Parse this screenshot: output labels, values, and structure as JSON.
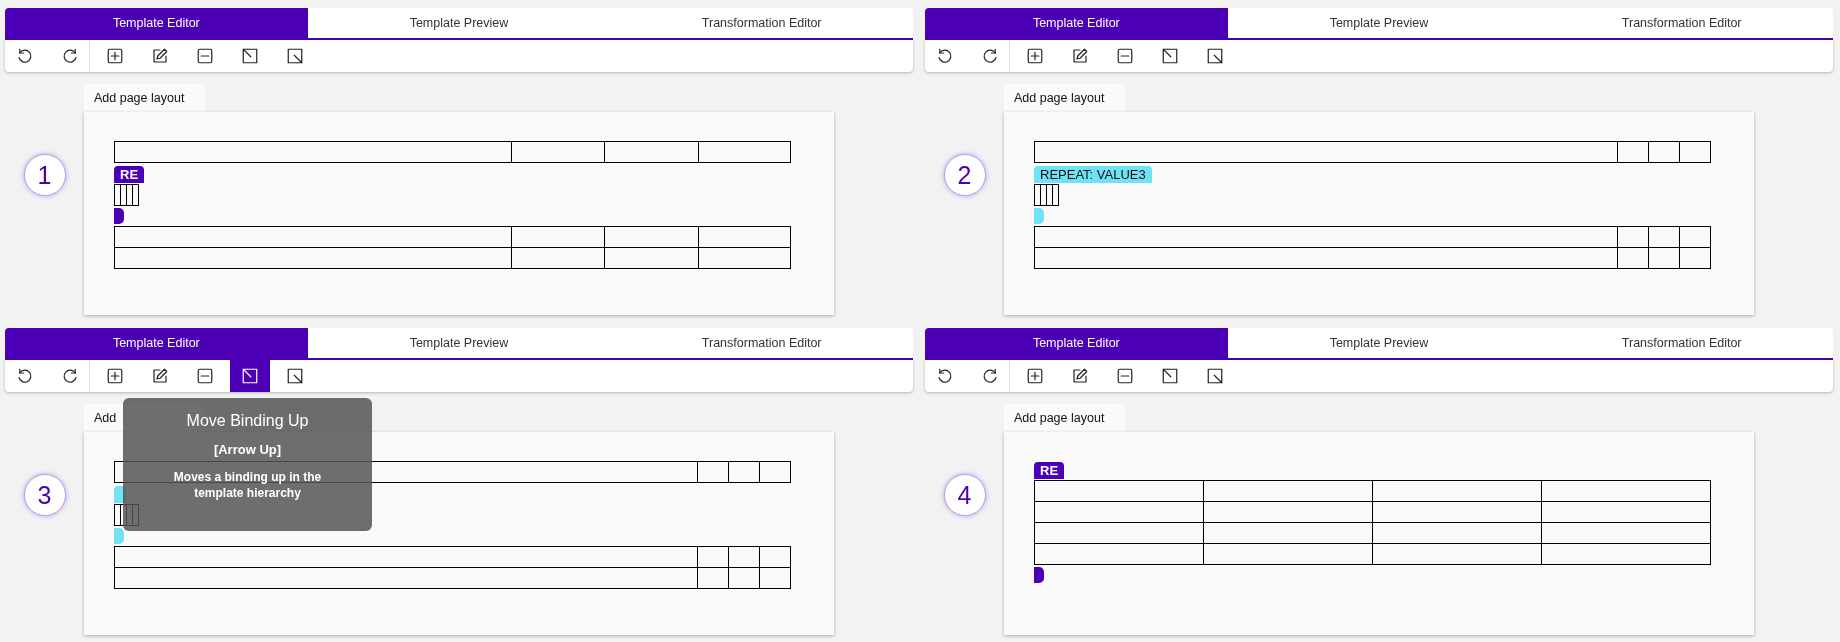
{
  "panels": [
    {
      "number": "1",
      "tabs": [
        {
          "label": "Template Editor",
          "selected": true
        },
        {
          "label": "Template Preview",
          "selected": false
        },
        {
          "label": "Transformation Editor",
          "selected": false
        }
      ],
      "toolbar": [
        {
          "kind": "undo",
          "selected": false
        },
        {
          "kind": "redo",
          "selected": false
        },
        {
          "kind": "add",
          "selected": false
        },
        {
          "kind": "edit",
          "selected": false
        },
        {
          "kind": "remove",
          "selected": false
        },
        {
          "kind": "move-up",
          "selected": false
        },
        {
          "kind": "move-down",
          "selected": false
        }
      ],
      "layout_tab": "Add page layout",
      "kind": "wide-first",
      "blocks": [
        {
          "kind": "single-row-table"
        },
        {
          "kind": "repeat-start",
          "label": "RE",
          "color": "#4b00b5"
        },
        {
          "kind": "mini-table"
        },
        {
          "kind": "repeat-end",
          "color": "#4b00b5"
        },
        {
          "kind": "double-row-table"
        }
      ]
    },
    {
      "number": "2",
      "tabs": [
        {
          "label": "Template Editor",
          "selected": true
        },
        {
          "label": "Template Preview",
          "selected": false
        },
        {
          "label": "Transformation Editor",
          "selected": false
        }
      ],
      "toolbar": [
        {
          "kind": "undo",
          "selected": false
        },
        {
          "kind": "redo",
          "selected": false
        },
        {
          "kind": "add",
          "selected": false
        },
        {
          "kind": "edit",
          "selected": false
        },
        {
          "kind": "remove",
          "selected": false
        },
        {
          "kind": "move-up",
          "selected": false
        },
        {
          "kind": "move-down",
          "selected": false
        }
      ],
      "layout_tab": "Add page layout",
      "kind": "narrow-last",
      "blocks": [
        {
          "kind": "single-row-table"
        },
        {
          "kind": "repeat-start",
          "label": "REPEAT: VALUE3",
          "color": "#6fe3f5"
        },
        {
          "kind": "mini-table"
        },
        {
          "kind": "repeat-end",
          "color": "#6fe3f5"
        },
        {
          "kind": "double-row-table"
        }
      ]
    },
    {
      "number": "3",
      "tabs": [
        {
          "label": "Template Editor",
          "selected": true
        },
        {
          "label": "Template Preview",
          "selected": false
        },
        {
          "label": "Transformation Editor",
          "selected": false
        }
      ],
      "toolbar": [
        {
          "kind": "undo",
          "selected": false
        },
        {
          "kind": "redo",
          "selected": false
        },
        {
          "kind": "add",
          "selected": false
        },
        {
          "kind": "edit",
          "selected": false
        },
        {
          "kind": "remove",
          "selected": false
        },
        {
          "kind": "move-up",
          "selected": true
        },
        {
          "kind": "move-down",
          "selected": false
        }
      ],
      "tooltip": {
        "title": "Move Binding Up",
        "shortcut": "[Arrow Up]",
        "description": "Moves a binding up in the template hierarchy"
      },
      "layout_tab": "Add",
      "kind": "narrow-last",
      "blocks": [
        {
          "kind": "single-row-table"
        },
        {
          "kind": "repeat-start",
          "color": "#6fe3f5"
        },
        {
          "kind": "mini-table"
        },
        {
          "kind": "repeat-end",
          "color": "#6fe3f5"
        },
        {
          "kind": "double-row-table"
        }
      ]
    },
    {
      "number": "4",
      "tabs": [
        {
          "label": "Template Editor",
          "selected": true
        },
        {
          "label": "Template Preview",
          "selected": false
        },
        {
          "label": "Transformation Editor",
          "selected": false
        }
      ],
      "toolbar": [
        {
          "kind": "undo",
          "selected": false
        },
        {
          "kind": "redo",
          "selected": false
        },
        {
          "kind": "add",
          "selected": false
        },
        {
          "kind": "edit",
          "selected": false
        },
        {
          "kind": "remove",
          "selected": false
        },
        {
          "kind": "move-up",
          "selected": false
        },
        {
          "kind": "move-down",
          "selected": false
        }
      ],
      "layout_tab": "Add page layout",
      "kind": "equal",
      "blocks": [
        {
          "kind": "repeat-start",
          "label": "RE",
          "color": "#4b00b5"
        },
        {
          "kind": "four-row-table"
        },
        {
          "kind": "repeat-end",
          "color": "#4b00b5"
        }
      ]
    }
  ]
}
